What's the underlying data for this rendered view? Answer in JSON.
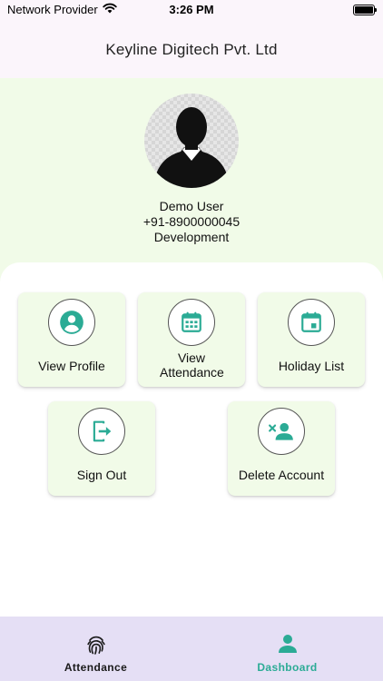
{
  "status_bar": {
    "carrier": "Network Provider",
    "time": "3:26 PM",
    "icons": [
      "wifi-icon",
      "battery-icon"
    ]
  },
  "header": {
    "title": "Keyline Digitech Pvt. Ltd"
  },
  "profile": {
    "avatar_icon": "user-silhouette-icon",
    "name": "Demo User",
    "phone": "+91-8900000045",
    "department": "Development"
  },
  "actions": {
    "view_profile": {
      "label": "View Profile",
      "icon": "account-circle-icon"
    },
    "view_attendance": {
      "label": "View Attendance",
      "icon": "calendar-grid-icon"
    },
    "holiday_list": {
      "label": "Holiday List",
      "icon": "calendar-event-icon"
    },
    "sign_out": {
      "label": "Sign Out",
      "icon": "exit-icon"
    },
    "delete_account": {
      "label": "Delete Account",
      "icon": "remove-user-icon"
    }
  },
  "bottom_nav": {
    "attendance": {
      "label": "Attendance",
      "icon": "fingerprint-icon",
      "active": false
    },
    "dashboard": {
      "label": "Dashboard",
      "icon": "person-icon",
      "active": true
    }
  },
  "colors": {
    "accent": "#2bab95",
    "header_bg": "#fbf5fb",
    "card_bg": "#f1fbe8",
    "nav_bg": "#e5dff5"
  }
}
